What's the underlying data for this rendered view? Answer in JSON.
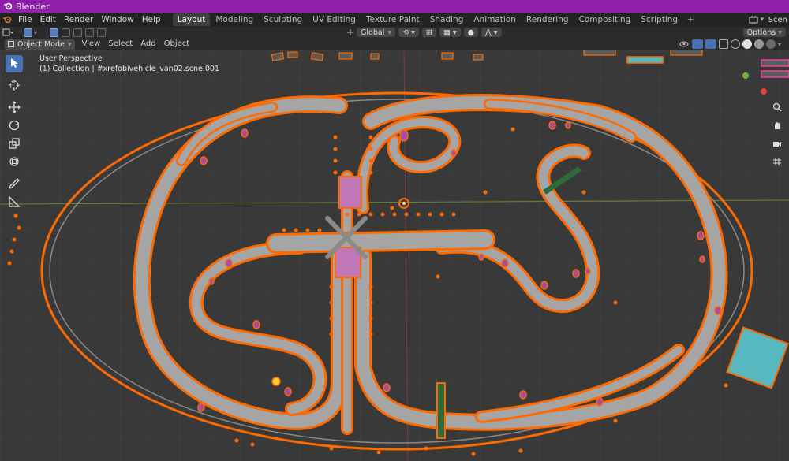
{
  "window": {
    "title": "Blender"
  },
  "menu": {
    "items": [
      "File",
      "Edit",
      "Render",
      "Window",
      "Help"
    ]
  },
  "workspaces": {
    "tabs": [
      "Layout",
      "Modeling",
      "Sculpting",
      "UV Editing",
      "Texture Paint",
      "Shading",
      "Animation",
      "Rendering",
      "Compositing",
      "Scripting"
    ],
    "active": "Layout",
    "add_label": "+"
  },
  "scene_selector": {
    "label": "Scen"
  },
  "tool_header": {
    "orientation": "Global",
    "options_label": "Options"
  },
  "viewport_header": {
    "mode": "Object Mode",
    "view": "View",
    "select": "Select",
    "add": "Add",
    "object": "Object"
  },
  "viewport": {
    "perspective_label": "User Perspective",
    "collection_label": "(1) Collection | #xrefobivehicle_van02.scne.001"
  },
  "colors": {
    "titlebar": "#8f1fa8",
    "selection_orange": "#ff6a00",
    "road_gray": "#9a9a9a",
    "active_tool": "#4772b3",
    "viewport_bg": "#393939"
  },
  "icons": {
    "toolbar": [
      "cursor-select-icon",
      "cursor-3d-icon",
      "move-icon",
      "rotate-icon",
      "scale-icon",
      "transform-icon",
      "annotate-icon",
      "measure-icon"
    ],
    "nav": [
      "zoom-icon",
      "pan-icon",
      "camera-icon",
      "grid-icon"
    ]
  }
}
